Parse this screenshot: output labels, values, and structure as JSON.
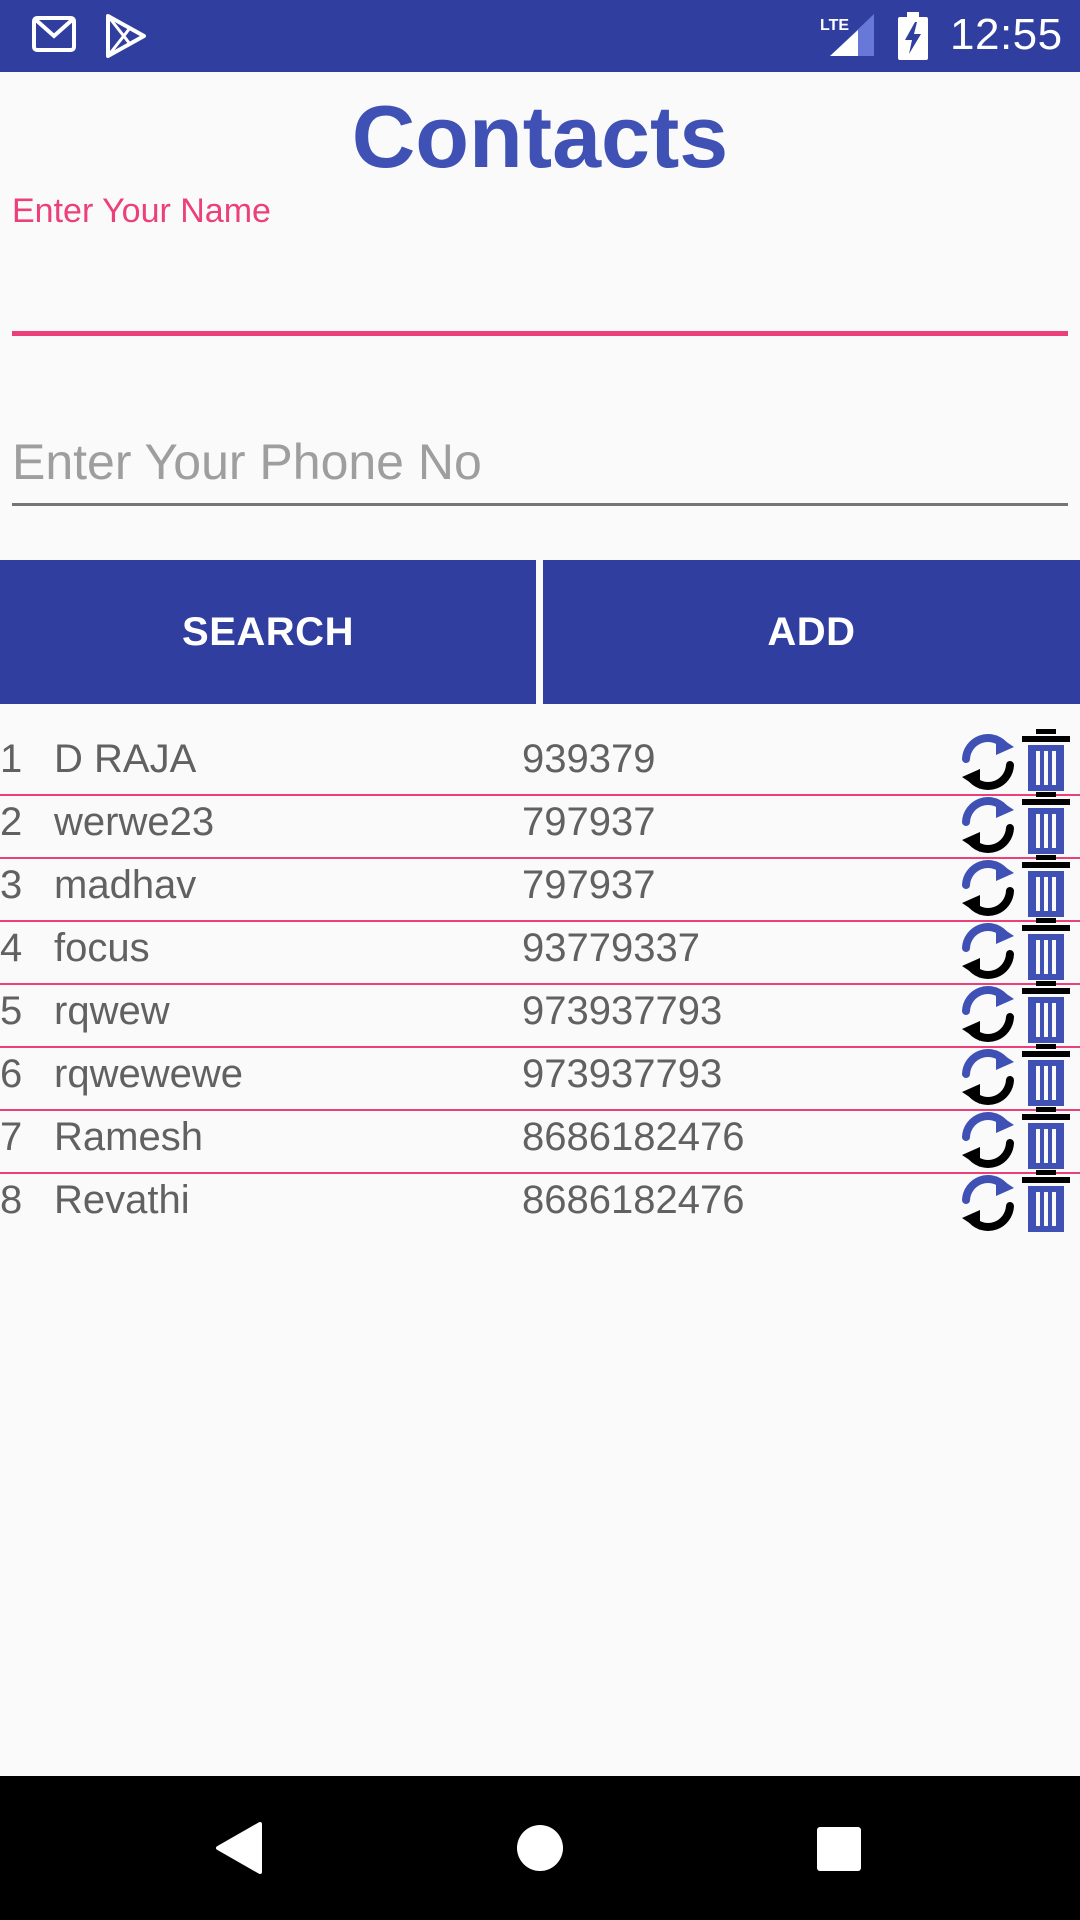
{
  "status_bar": {
    "time": "12:55",
    "icons": [
      "gmail-icon",
      "play-store-icon",
      "lte-signal-icon",
      "battery-charging-icon"
    ],
    "background_color": "#303f9f"
  },
  "title": "Contacts",
  "name_field": {
    "label": "Enter Your Name",
    "value": ""
  },
  "phone_field": {
    "placeholder": "Enter Your Phone No",
    "value": ""
  },
  "buttons": {
    "search_label": "SEARCH",
    "add_label": "ADD"
  },
  "contacts": [
    {
      "num": "1",
      "name": "D RAJA",
      "phone": "939379"
    },
    {
      "num": "2",
      "name": "werwe23",
      "phone": "797937"
    },
    {
      "num": "3",
      "name": "madhav",
      "phone": "797937"
    },
    {
      "num": "4",
      "name": "focus",
      "phone": "93779337"
    },
    {
      "num": "5",
      "name": "rqwew",
      "phone": "973937793"
    },
    {
      "num": "6",
      "name": "rqwewewe",
      "phone": "973937793"
    },
    {
      "num": "7",
      "name": "Ramesh",
      "phone": "8686182476"
    },
    {
      "num": "8",
      "name": "Revathi",
      "phone": "8686182476"
    }
  ],
  "row_action_icons": [
    "refresh-icon",
    "delete-icon"
  ],
  "nav_bar": {
    "icons": [
      "back-icon",
      "home-icon",
      "recents-icon"
    ]
  },
  "colors": {
    "primary": "#303f9f",
    "title": "#3f51b5",
    "accent": "#ec407a",
    "text_secondary": "#616161"
  }
}
